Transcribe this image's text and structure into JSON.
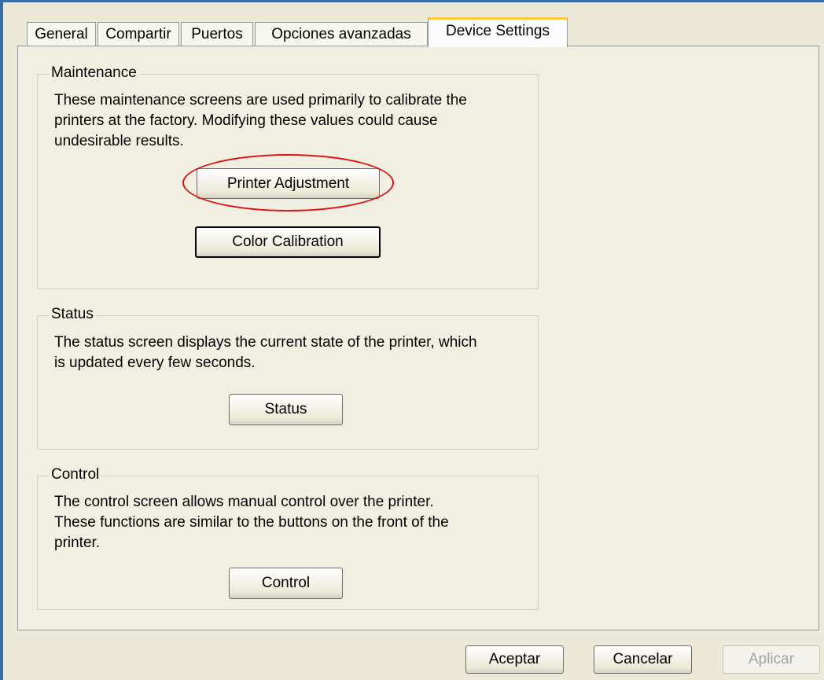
{
  "tabs": [
    {
      "label": "General"
    },
    {
      "label": "Compartir"
    },
    {
      "label": "Puertos"
    },
    {
      "label": "Opciones avanzadas"
    },
    {
      "label": "Device Settings",
      "active": true
    }
  ],
  "maintenance": {
    "title": "Maintenance",
    "lines": [
      "These maintenance screens are used primarily to calibrate the",
      "printers at the factory.  Modifying these values could cause",
      "undesirable results."
    ],
    "printer_adjustment_label": "Printer Adjustment",
    "color_calibration_label": "Color Calibration"
  },
  "status": {
    "title": "Status",
    "lines": [
      "The status screen displays the current state of the printer, which",
      "is updated every few seconds."
    ],
    "button_label": "Status"
  },
  "control": {
    "title": "Control",
    "lines": [
      "The control screen allows manual control over the printer.",
      "These functions are similar to the buttons on the front of the",
      "printer."
    ],
    "button_label": "Control"
  },
  "dialog_buttons": {
    "accept_label": "Aceptar",
    "cancel_label": "Cancelar",
    "apply_label": "Aplicar"
  },
  "highlight_color": "#e01010"
}
